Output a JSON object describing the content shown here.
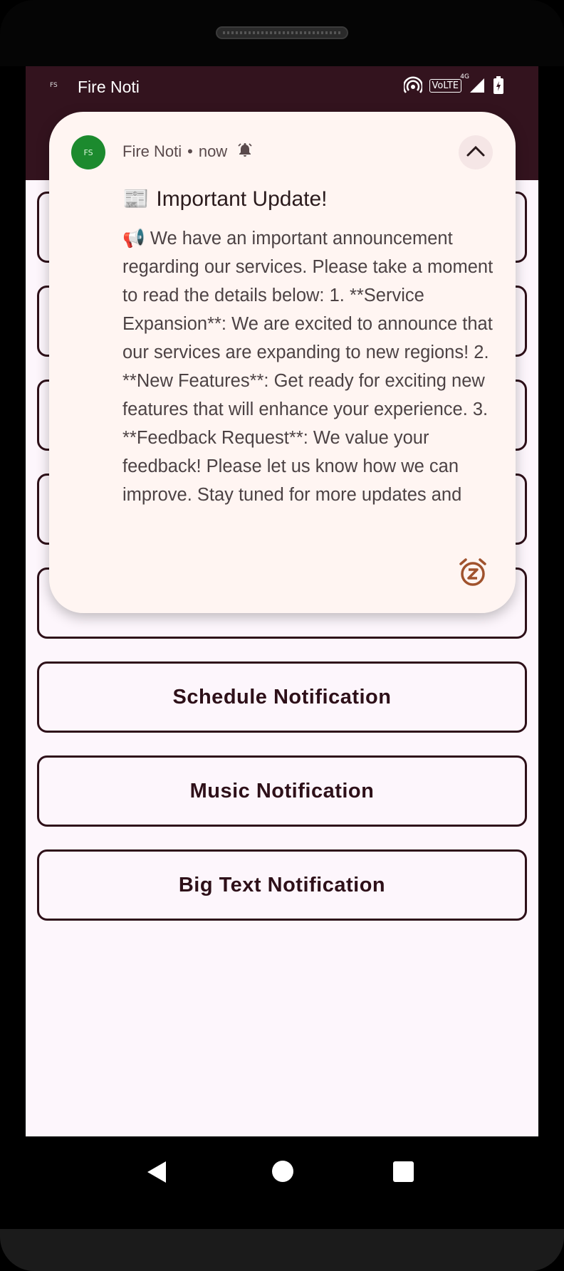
{
  "status_bar": {
    "app_icon_text": "FS",
    "app_name": "Fire Noti",
    "network_label": "VoLTE",
    "network_gen": "4G"
  },
  "buttons": [
    {
      "label": "Schedule Notification"
    },
    {
      "label": "Music Notification"
    },
    {
      "label": "Big Text Notification"
    }
  ],
  "notification": {
    "avatar_text": "FS",
    "app_name": "Fire Noti",
    "separator": "•",
    "time": "now",
    "title_emoji": "📰",
    "title": "Important Update!",
    "body_emoji": "📢",
    "body": "We have an important announcement regarding our services. Please take a moment to read the details below: 1. **Service Expansion**: We are excited to announce that our services are expanding to new regions! 2. **New Features**: Get ready for exciting new features that will enhance your experience. 3. **Feedback Request**: We value your feedback! Please let us know how we can improve. Stay tuned for more updates and thank"
  },
  "icons": {
    "bell": "bell-icon",
    "collapse": "chevron-up-icon",
    "snooze": "snooze-icon",
    "hotspot": "hotspot-icon",
    "signal": "signal-icon",
    "battery": "battery-charging-icon",
    "back": "back-icon",
    "home": "home-icon",
    "recents": "recents-icon"
  },
  "colors": {
    "status_bar": "#33131e",
    "screen_bg": "#fdf6fc",
    "button_border": "#2e1019",
    "notification_bg": "#fff5f2",
    "avatar": "#1c8a2e",
    "snooze_accent": "#a0522d"
  }
}
